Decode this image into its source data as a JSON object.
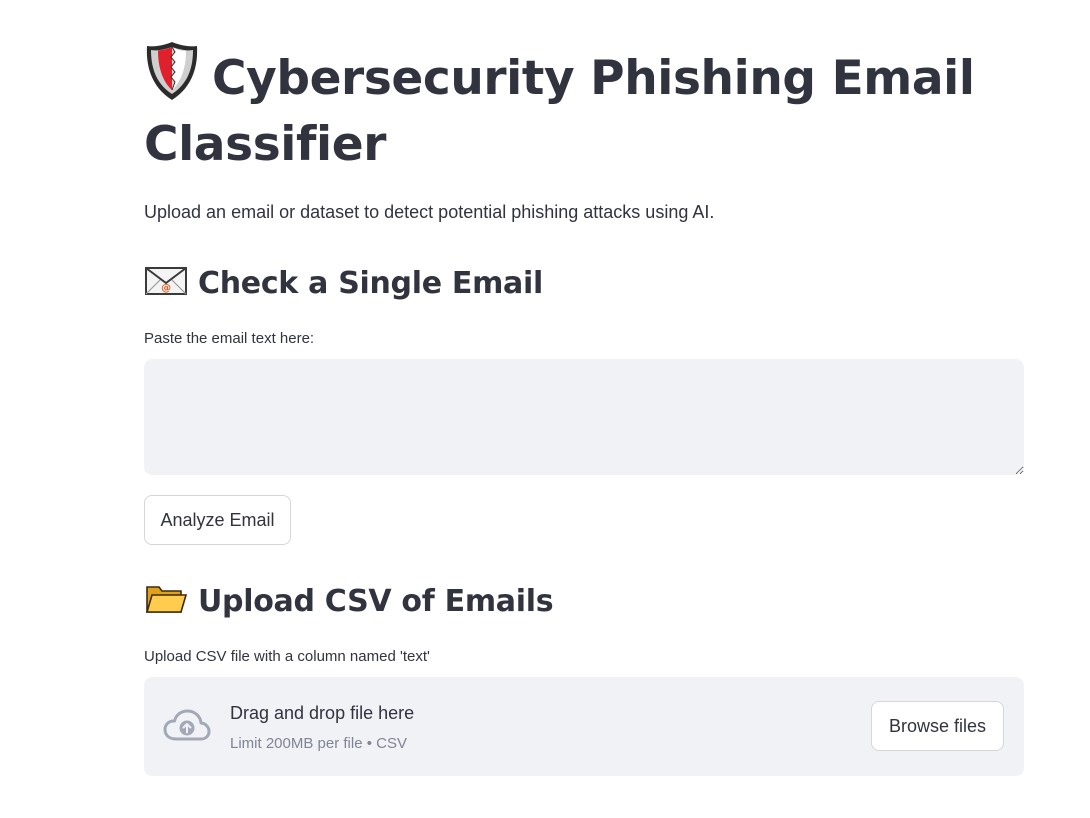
{
  "header": {
    "title_icon": "shield-icon",
    "title": "Cybersecurity Phishing Email Classifier",
    "subtitle": "Upload an email or dataset to detect potential phishing attacks using AI."
  },
  "single_email": {
    "heading_icon": "envelope-icon",
    "heading": "Check a Single Email",
    "input_label": "Paste the email text here:",
    "input_value": "",
    "analyze_label": "Analyze Email"
  },
  "csv_upload": {
    "heading_icon": "folder-icon",
    "heading": "Upload CSV of Emails",
    "input_label": "Upload CSV file with a column named 'text'",
    "dropzone_title": "Drag and drop file here",
    "dropzone_limit": "Limit 200MB per file • CSV",
    "browse_label": "Browse files"
  },
  "colors": {
    "text": "#31333f",
    "input_bg": "#f0f2f6",
    "muted": "#808495",
    "border": "#d6d6d9",
    "shield_red": "#e0202a"
  }
}
